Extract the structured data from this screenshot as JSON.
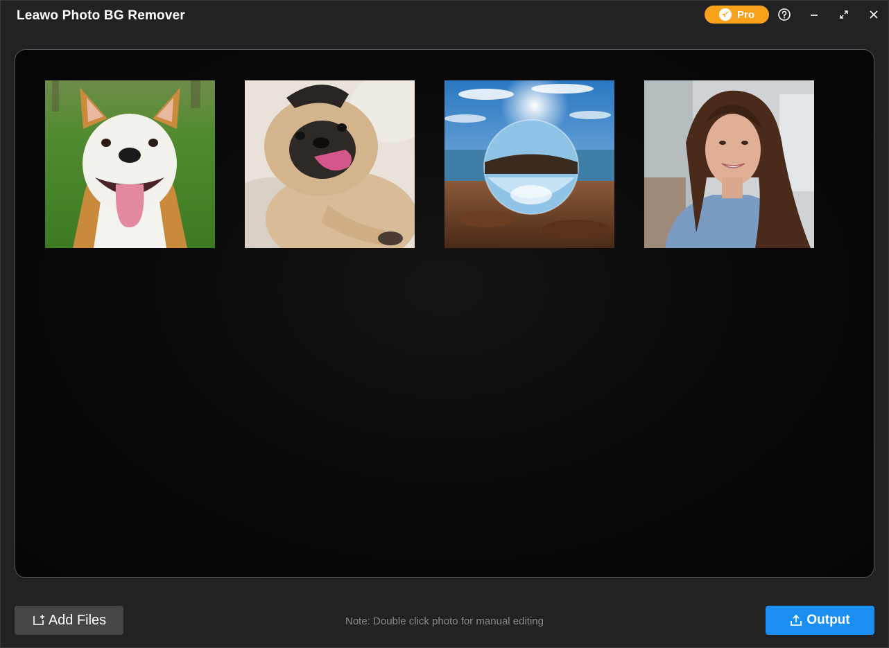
{
  "app": {
    "title": "Leawo Photo BG Remover"
  },
  "titlebar": {
    "pro_label": "Pro",
    "pro_color": "#f7a21a",
    "icons": [
      "rocket-icon",
      "help-icon",
      "minimize-icon",
      "maximize-icon",
      "close-icon"
    ]
  },
  "photos": [
    {
      "subject": "dog",
      "icon": "photo-thumbnail"
    },
    {
      "subject": "pug",
      "icon": "photo-thumbnail"
    },
    {
      "subject": "crystal ball",
      "icon": "photo-thumbnail"
    },
    {
      "subject": "woman portrait",
      "icon": "photo-thumbnail"
    }
  ],
  "footer": {
    "add_files_label": "Add Files",
    "note": "Note: Double click photo for manual editing",
    "output_label": "Output",
    "output_color": "#1b8ef2"
  }
}
